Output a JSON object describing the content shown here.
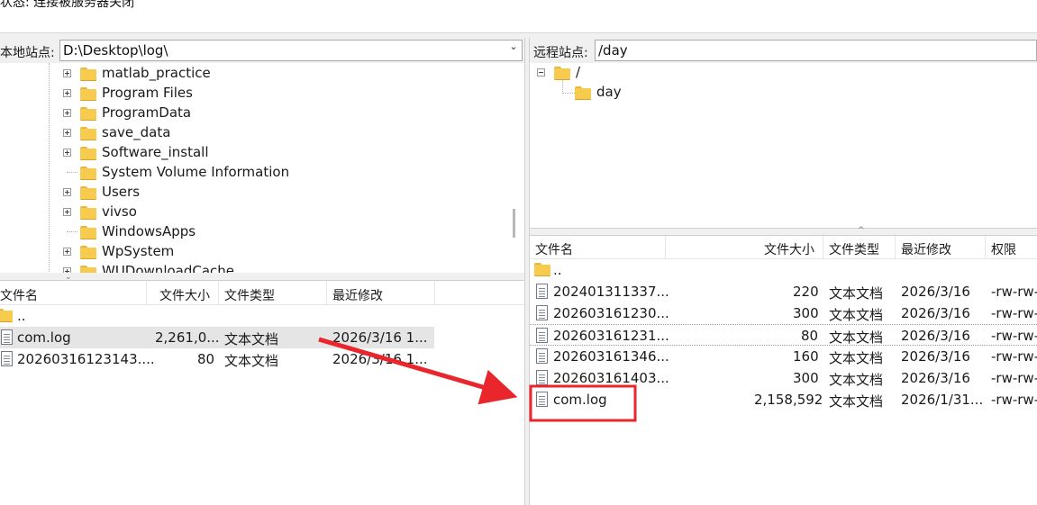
{
  "status": {
    "text": "状态:  连接被服务器关闭"
  },
  "local": {
    "site_label": "本地站点:",
    "path": "D:\\Desktop\\log\\",
    "tree": [
      {
        "label": "matlab_practice",
        "expandable": true
      },
      {
        "label": "Program Files",
        "expandable": true
      },
      {
        "label": "ProgramData",
        "expandable": true
      },
      {
        "label": "save_data",
        "expandable": true
      },
      {
        "label": "Software_install",
        "expandable": true
      },
      {
        "label": "System Volume Information",
        "expandable": false
      },
      {
        "label": "Users",
        "expandable": true
      },
      {
        "label": "vivso",
        "expandable": true
      },
      {
        "label": "WindowsApps",
        "expandable": false
      },
      {
        "label": "WpSystem",
        "expandable": true
      },
      {
        "label": "WUDownloadCache",
        "expandable": true
      }
    ],
    "columns": [
      "文件名",
      "文件大小",
      "文件类型",
      "最近修改"
    ],
    "files": [
      {
        "name": "..",
        "size": "",
        "type": "",
        "modified": "",
        "kind": "folder"
      },
      {
        "name": "com.log",
        "size": "2,261,0...",
        "type": "文本文档",
        "modified": "2026/3/16 1...",
        "kind": "file"
      },
      {
        "name": "20260316123143....",
        "size": "80",
        "type": "文本文档",
        "modified": "2026/3/16 1...",
        "kind": "file"
      }
    ]
  },
  "remote": {
    "site_label": "远程站点:",
    "path": "/day",
    "tree": [
      {
        "label": "/",
        "level": 0
      },
      {
        "label": "day",
        "level": 1
      }
    ],
    "columns": [
      "文件名",
      "文件大小",
      "文件类型",
      "最近修改",
      "权限"
    ],
    "files": [
      {
        "name": "..",
        "size": "",
        "type": "",
        "modified": "",
        "perm": "",
        "kind": "folder"
      },
      {
        "name": "202401311337...",
        "size": "220",
        "type": "文本文档",
        "modified": "2026/3/16",
        "perm": "-rw-rw-",
        "kind": "file"
      },
      {
        "name": "202603161230...",
        "size": "300",
        "type": "文本文档",
        "modified": "2026/3/16",
        "perm": "-rw-rw-",
        "kind": "file"
      },
      {
        "name": "202603161231...",
        "size": "80",
        "type": "文本文档",
        "modified": "2026/3/16",
        "perm": "-rw-rw-",
        "kind": "file"
      },
      {
        "name": "202603161346...",
        "size": "160",
        "type": "文本文档",
        "modified": "2026/3/16",
        "perm": "-rw-rw-",
        "kind": "file"
      },
      {
        "name": "202603161403...",
        "size": "300",
        "type": "文本文档",
        "modified": "2026/3/16",
        "perm": "-rw-rw-",
        "kind": "file"
      },
      {
        "name": "com.log",
        "size": "2,158,592",
        "type": "文本文档",
        "modified": "2026/1/31...",
        "perm": "-rw-rw-",
        "kind": "file"
      }
    ]
  },
  "annotation": {
    "arrow_color": "#e8262b",
    "box_color": "#e8262b"
  }
}
